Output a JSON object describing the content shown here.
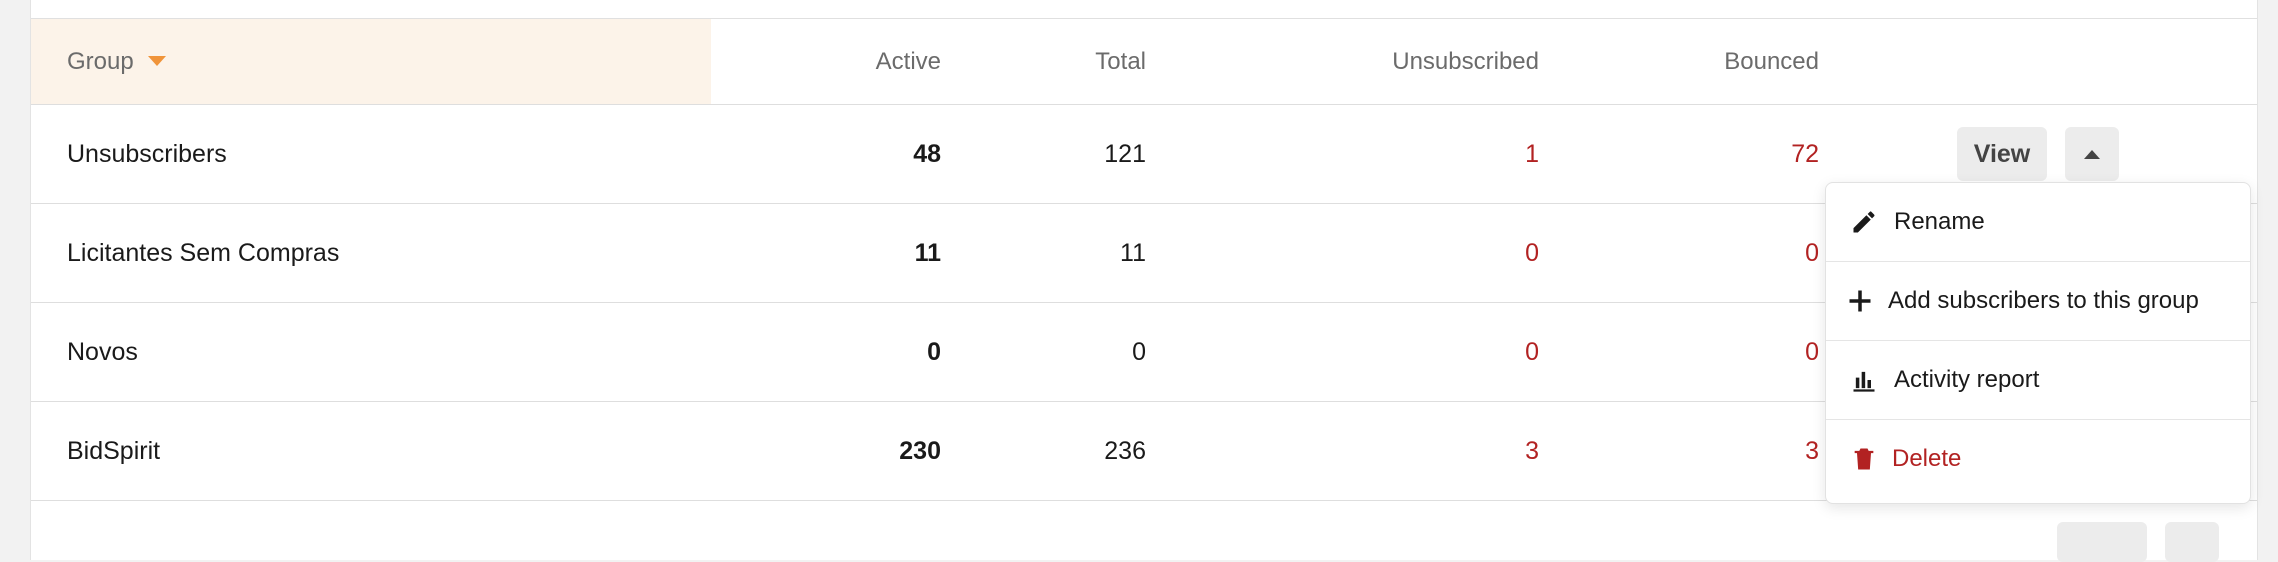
{
  "table": {
    "columns": {
      "group": "Group",
      "active": "Active",
      "total": "Total",
      "unsubscribed": "Unsubscribed",
      "bounced": "Bounced"
    },
    "rows": [
      {
        "name": "Unsubscribers",
        "active": "48",
        "total": "121",
        "unsubscribed": "1",
        "bounced": "72"
      },
      {
        "name": "Licitantes Sem Compras",
        "active": "11",
        "total": "11",
        "unsubscribed": "0",
        "bounced": "0"
      },
      {
        "name": "Novos",
        "active": "0",
        "total": "0",
        "unsubscribed": "0",
        "bounced": "0"
      },
      {
        "name": "BidSpirit",
        "active": "230",
        "total": "236",
        "unsubscribed": "3",
        "bounced": "3"
      }
    ],
    "view_label": "View"
  },
  "dropdown": {
    "items": [
      {
        "label": "Rename",
        "icon": "pencil-icon"
      },
      {
        "label": "Add subscribers to this group",
        "icon": "plus-icon"
      },
      {
        "label": "Activity report",
        "icon": "bar-chart-icon"
      },
      {
        "label": "Delete",
        "icon": "trash-icon"
      }
    ]
  },
  "colors": {
    "sort_accent": "#f0943a",
    "header_highlight": "#fcf3e9",
    "danger": "#b22222"
  }
}
